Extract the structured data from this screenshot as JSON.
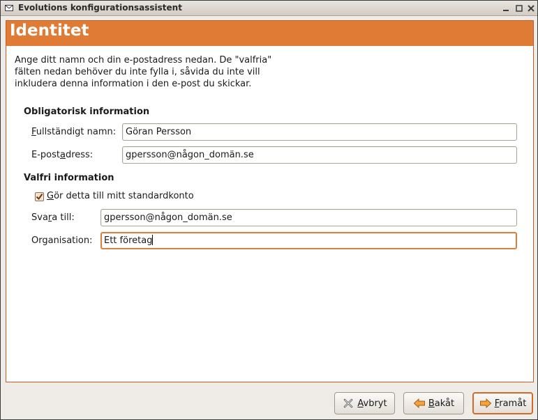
{
  "window": {
    "title": "Evolutions konfigurationsassistent",
    "minimize_icon": "minimize-icon",
    "maximize_icon": "maximize-icon",
    "close_icon": "close-icon"
  },
  "header": {
    "title": "Identitet",
    "color": "#e07b35"
  },
  "intro": {
    "line1": "Ange ditt namn och din e-postadress nedan. De \"valfria\"",
    "line2": "fälten nedan behöver du inte fylla i, såvida du inte vill",
    "line3": "inkludera denna information i den e-post du skickar."
  },
  "required": {
    "section_title": "Obligatorisk information",
    "fullname": {
      "label_mnemonic": "F",
      "label_rest": "ullständigt namn:",
      "value": "Göran Persson"
    },
    "email": {
      "label_pre": "E-post",
      "label_mnemonic": "a",
      "label_post": "dress:",
      "value": "gpersson@någon_domän.se"
    }
  },
  "optional": {
    "section_title": "Valfri information",
    "default_account": {
      "label_mnemonic": "G",
      "label_rest": "ör detta till mitt standardkonto",
      "checked": true
    },
    "reply_to": {
      "label_pre": "Sva",
      "label_mnemonic": "r",
      "label_post": "a till:",
      "value": "gpersson@någon_domän.se"
    },
    "organization": {
      "label": "Organisation:",
      "value": "Ett företag"
    }
  },
  "buttons": {
    "cancel": {
      "mnemonic": "A",
      "rest": "vbryt",
      "icon": "cancel-x-icon"
    },
    "back": {
      "mnemonic": "B",
      "rest": "akåt",
      "icon": "back-arrow-icon"
    },
    "forward": {
      "mnemonic": "F",
      "rest": "ramåt",
      "icon": "forward-arrow-icon"
    }
  }
}
